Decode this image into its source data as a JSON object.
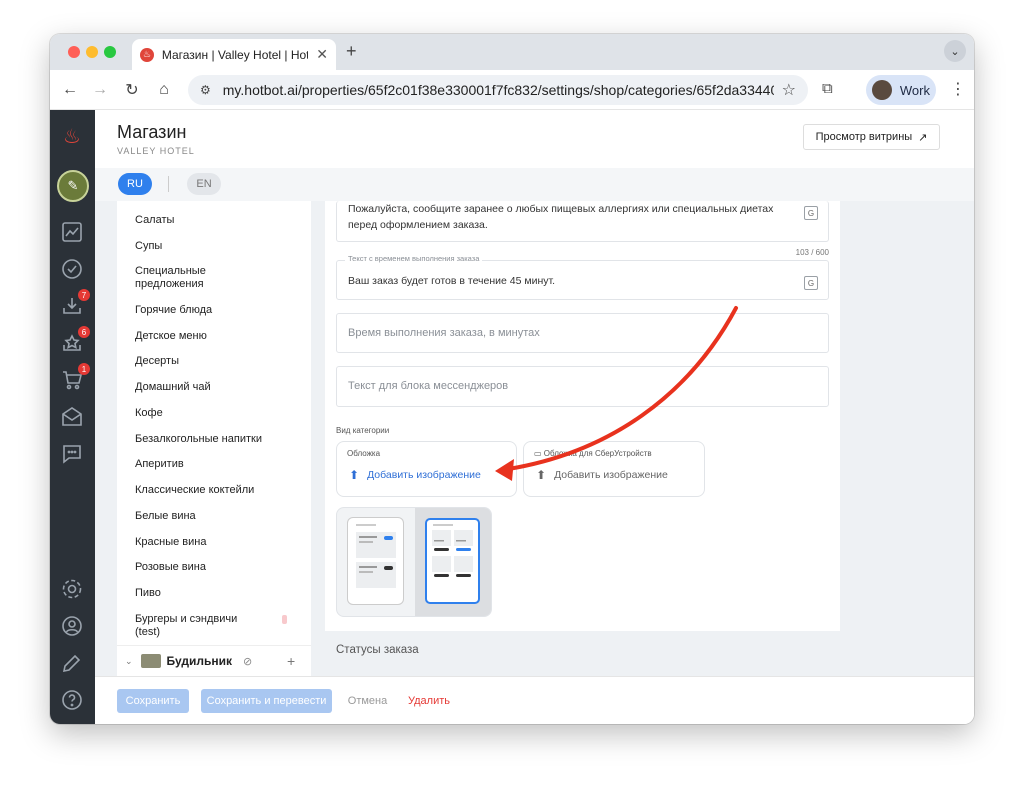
{
  "browser": {
    "tab_title": "Магазин | Valley Hotel | Hotbot",
    "url": "my.hotbot.ai/properties/65f2c01f38e330001f7fc832/settings/shop/categories/65f2da33440...",
    "profile_label": "Work"
  },
  "sidebar": {
    "badges": {
      "inbox": "7",
      "reviews": "6",
      "cart": "1"
    }
  },
  "header": {
    "title": "Магазин",
    "subtitle": "VALLEY HOTEL",
    "showcase_button": "Просмотр витрины"
  },
  "languages": {
    "ru": "RU",
    "en": "EN"
  },
  "categories": [
    "Салаты",
    "Супы",
    "Специальные предложения",
    "Горячие блюда",
    "Детское меню",
    "Десерты",
    "Домашний чай",
    "Кофе",
    "Безалкогольные напитки",
    "Аперитив",
    "Классические коктейли",
    "Белые вина",
    "Красные вина",
    "Розовые вина",
    "Пиво",
    "Бургеры и сэндвичи (test)"
  ],
  "category_group": {
    "name": "Будильник"
  },
  "form": {
    "allergy_text": "Пожалуйста, сообщите заранее о любых пищевых аллергиях или специальных диетах перед оформлением заказа.",
    "allergy_counter": "103 / 600",
    "ready_time_label": "Текст с временем выполнения заказа",
    "ready_time_value": "Ваш заказ будет готов в течение 45 минут.",
    "minutes_placeholder": "Время выполнения заказа, в минутах",
    "messenger_placeholder": "Текст для блока мессенджеров",
    "view_label": "Вид категории",
    "cover_label": "Обложка",
    "cover_add": "Добавить изображение",
    "sber_label": "Обложка для СберУстройств",
    "sber_add": "Добавить изображение",
    "status_title": "Статусы заказа"
  },
  "footer": {
    "save": "Сохранить",
    "save_translate": "Сохранить и перевести",
    "cancel": "Отмена",
    "delete": "Удалить"
  },
  "colors": {
    "accent": "#2f80ed",
    "danger": "#e53935",
    "annotation_arrow": "#e8321e"
  }
}
